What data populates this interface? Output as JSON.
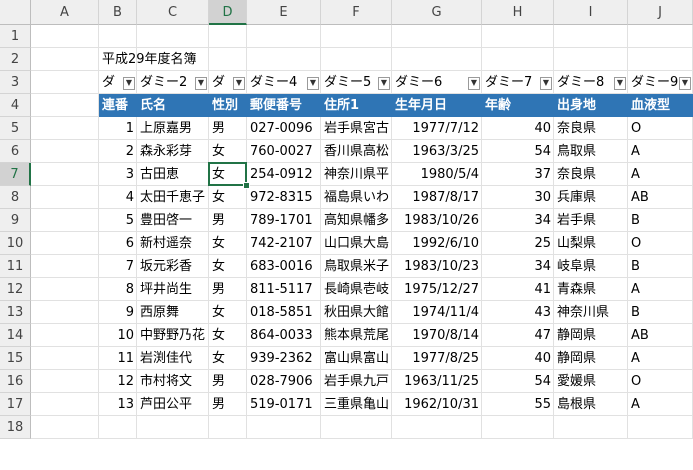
{
  "columns": [
    "A",
    "B",
    "C",
    "D",
    "E",
    "F",
    "G",
    "H",
    "I",
    "J"
  ],
  "rows": [
    "1",
    "2",
    "3",
    "4",
    "5",
    "6",
    "7",
    "8",
    "9",
    "10",
    "11",
    "12",
    "13",
    "14",
    "15",
    "16",
    "17",
    "18"
  ],
  "selected": {
    "col": "D",
    "row": "7"
  },
  "colors": {
    "table_header_bg": "#2f75b5",
    "selection": "#217346"
  },
  "title": "平成29年度名簿",
  "dummy_headers": [
    "ダ",
    "ダミー2",
    "ダ",
    "ダミー4",
    "ダミー5",
    "ダミー6",
    "ダミー7",
    "ダミー8",
    "ダミー9"
  ],
  "table_headers": [
    "連番",
    "氏名",
    "性別",
    "郵便番号",
    "住所1",
    "生年月日",
    "年齢",
    "出身地",
    "血液型"
  ],
  "table_rows": [
    [
      "1",
      "上原嘉男",
      "男",
      "027-0096",
      "岩手県宮古",
      "1977/7/12",
      "40",
      "奈良県",
      "O"
    ],
    [
      "2",
      "森永彩芽",
      "女",
      "760-0027",
      "香川県高松",
      "1963/3/25",
      "54",
      "鳥取県",
      "A"
    ],
    [
      "3",
      "古田恵",
      "女",
      "254-0912",
      "神奈川県平",
      "1980/5/4",
      "37",
      "奈良県",
      "A"
    ],
    [
      "4",
      "太田千恵子",
      "女",
      "972-8315",
      "福島県いわ",
      "1987/8/17",
      "30",
      "兵庫県",
      "AB"
    ],
    [
      "5",
      "豊田啓一",
      "男",
      "789-1701",
      "高知県幡多",
      "1983/10/26",
      "34",
      "岩手県",
      "B"
    ],
    [
      "6",
      "新村遥奈",
      "女",
      "742-2107",
      "山口県大島",
      "1992/6/10",
      "25",
      "山梨県",
      "O"
    ],
    [
      "7",
      "坂元彩香",
      "女",
      "683-0016",
      "鳥取県米子",
      "1983/10/23",
      "34",
      "岐阜県",
      "B"
    ],
    [
      "8",
      "坪井尚生",
      "男",
      "811-5117",
      "長崎県壱岐",
      "1975/12/27",
      "41",
      "青森県",
      "A"
    ],
    [
      "9",
      "西原舞",
      "女",
      "018-5851",
      "秋田県大館",
      "1974/11/4",
      "43",
      "神奈川県",
      "B"
    ],
    [
      "10",
      "中野野乃花",
      "女",
      "864-0033",
      "熊本県荒尾",
      "1970/8/14",
      "47",
      "静岡県",
      "AB"
    ],
    [
      "11",
      "岩渕佳代",
      "女",
      "939-2362",
      "富山県富山",
      "1977/8/25",
      "40",
      "静岡県",
      "A"
    ],
    [
      "12",
      "市村将文",
      "男",
      "028-7906",
      "岩手県九戸",
      "1963/11/25",
      "54",
      "愛媛県",
      "O"
    ],
    [
      "13",
      "芦田公平",
      "男",
      "519-0171",
      "三重県亀山",
      "1962/10/31",
      "55",
      "島根県",
      "A"
    ]
  ]
}
